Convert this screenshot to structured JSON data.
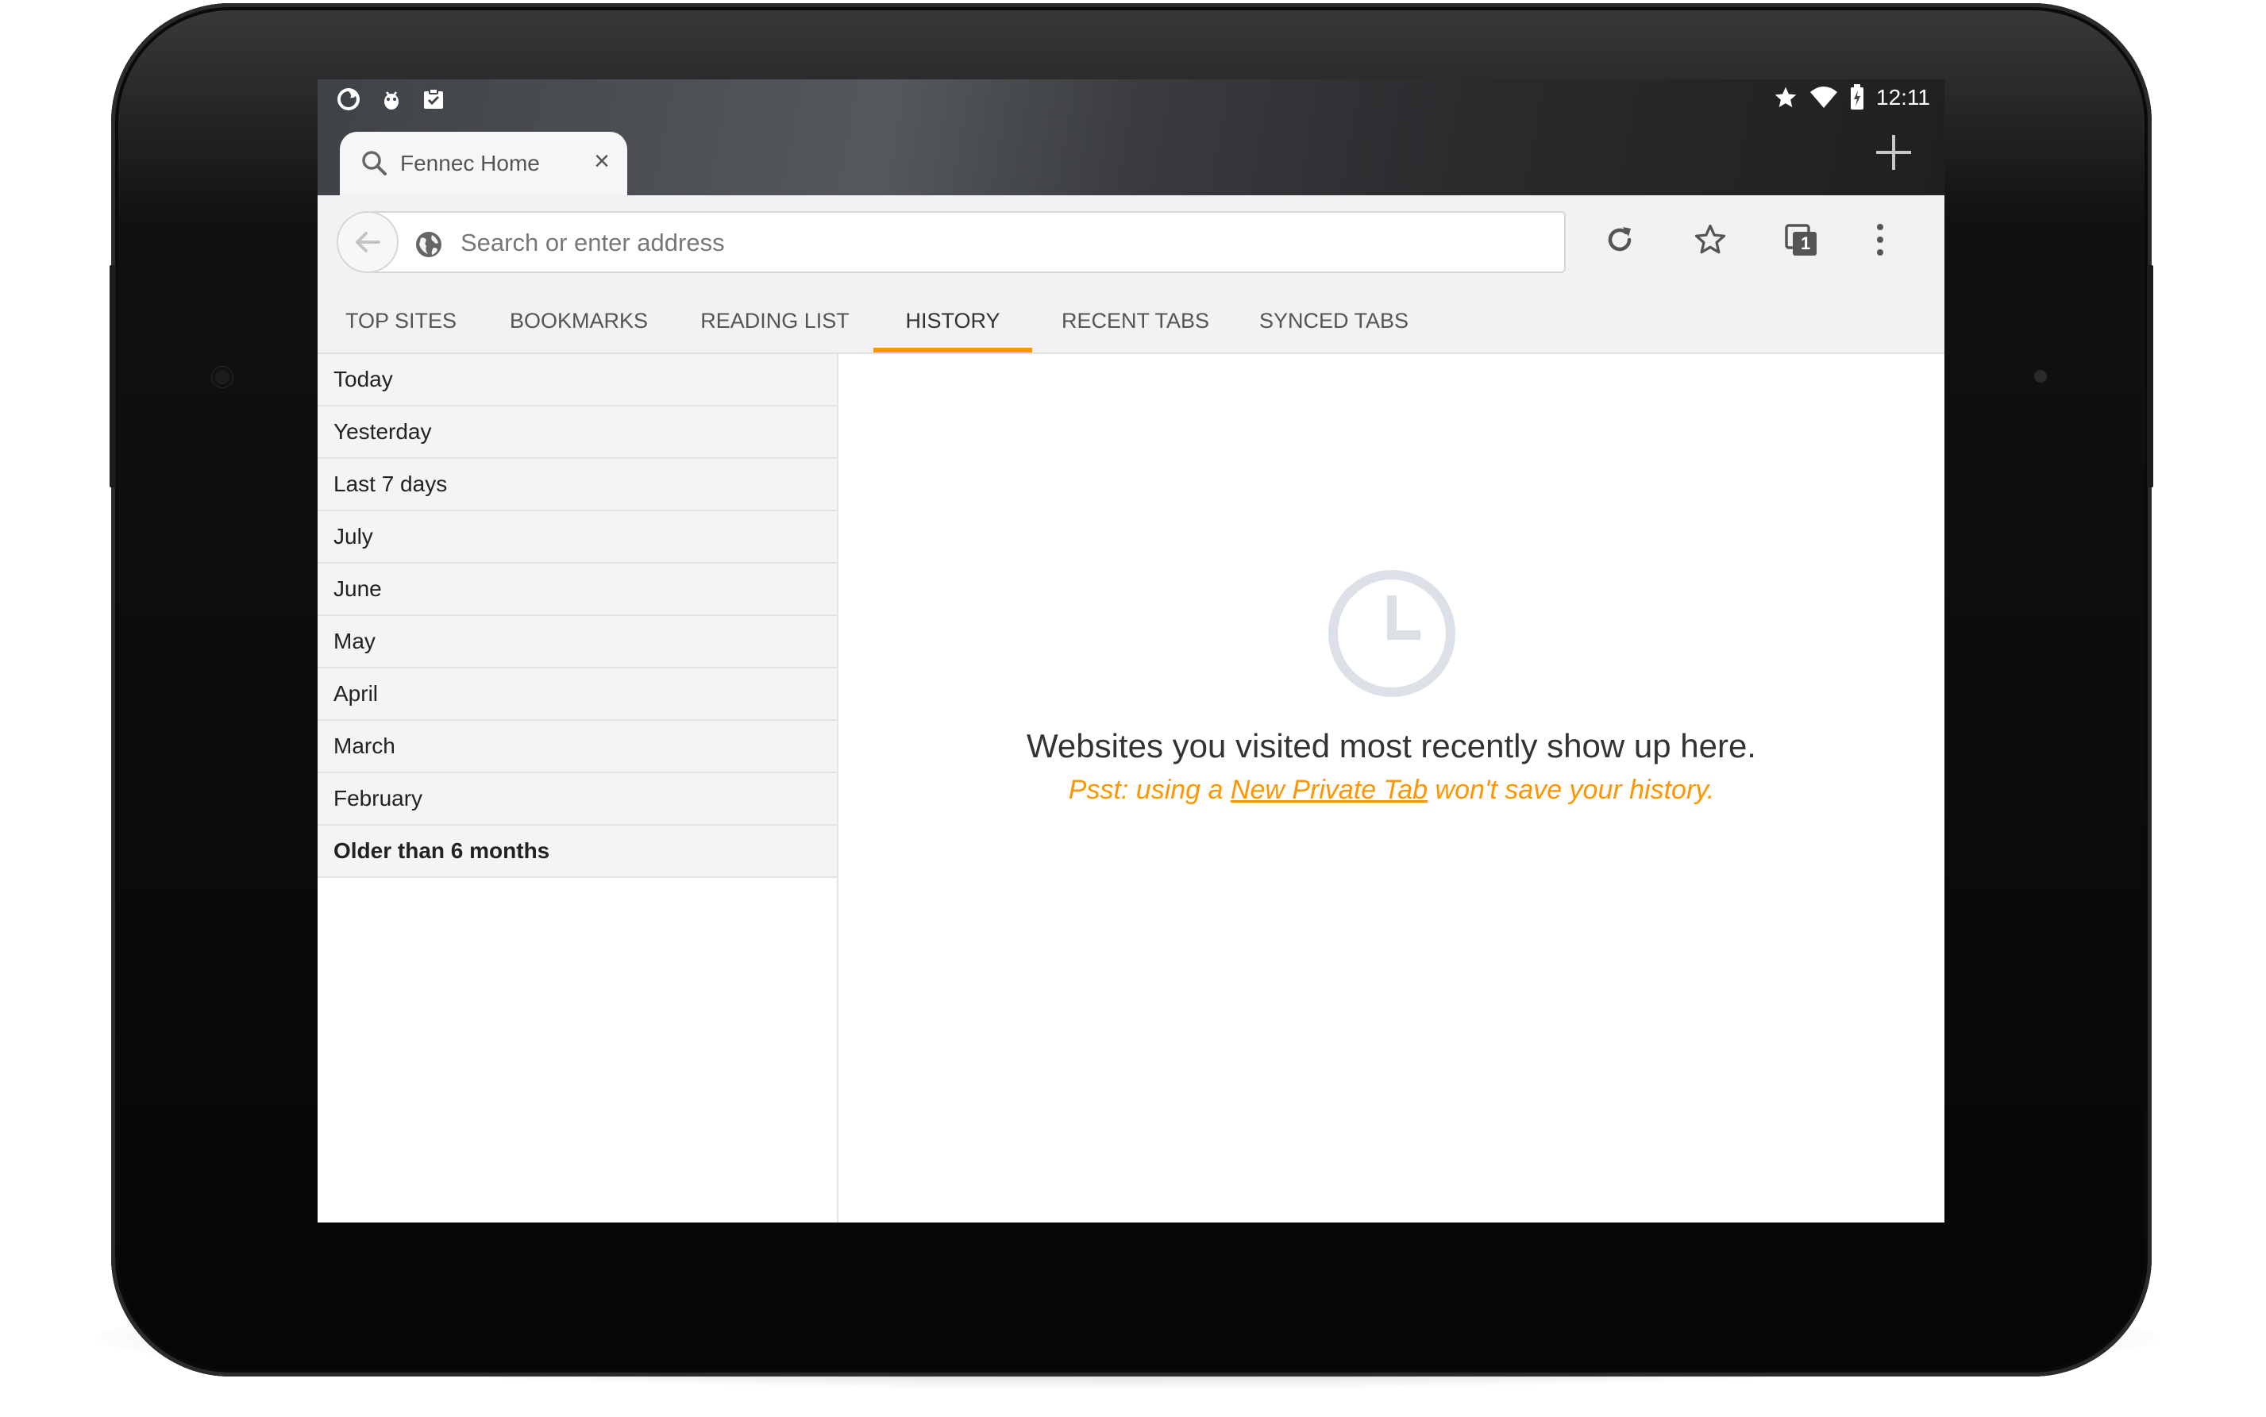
{
  "status_bar": {
    "left_icons": [
      "firefox-notification-icon",
      "android-debug-icon",
      "clipboard-check-icon"
    ],
    "right_icons": [
      "star-icon",
      "wifi-icon",
      "battery-charging-icon"
    ],
    "time": "12:11"
  },
  "browser_tab": {
    "title": "Fennec Home",
    "close_glyph": "×"
  },
  "urlbar": {
    "placeholder": "Search or enter address"
  },
  "panel_tabs": [
    {
      "label": "TOP SITES"
    },
    {
      "label": "BOOKMARKS"
    },
    {
      "label": "READING LIST"
    },
    {
      "label": "HISTORY"
    },
    {
      "label": "RECENT TABS"
    },
    {
      "label": "SYNCED TABS"
    }
  ],
  "active_panel": "HISTORY",
  "tab_count": "1",
  "history_ranges": [
    "Today",
    "Yesterday",
    "Last 7 days",
    "July",
    "June",
    "May",
    "April",
    "March",
    "February",
    "Older than 6 months"
  ],
  "empty_state": {
    "message": "Websites you visited most recently show up here.",
    "hint_prefix": "Psst: using a ",
    "hint_link": "New Private Tab",
    "hint_suffix": " won't save your history."
  },
  "colors": {
    "accent": "#ff9500",
    "chrome": "#f2f2f2",
    "text": "#333333"
  }
}
